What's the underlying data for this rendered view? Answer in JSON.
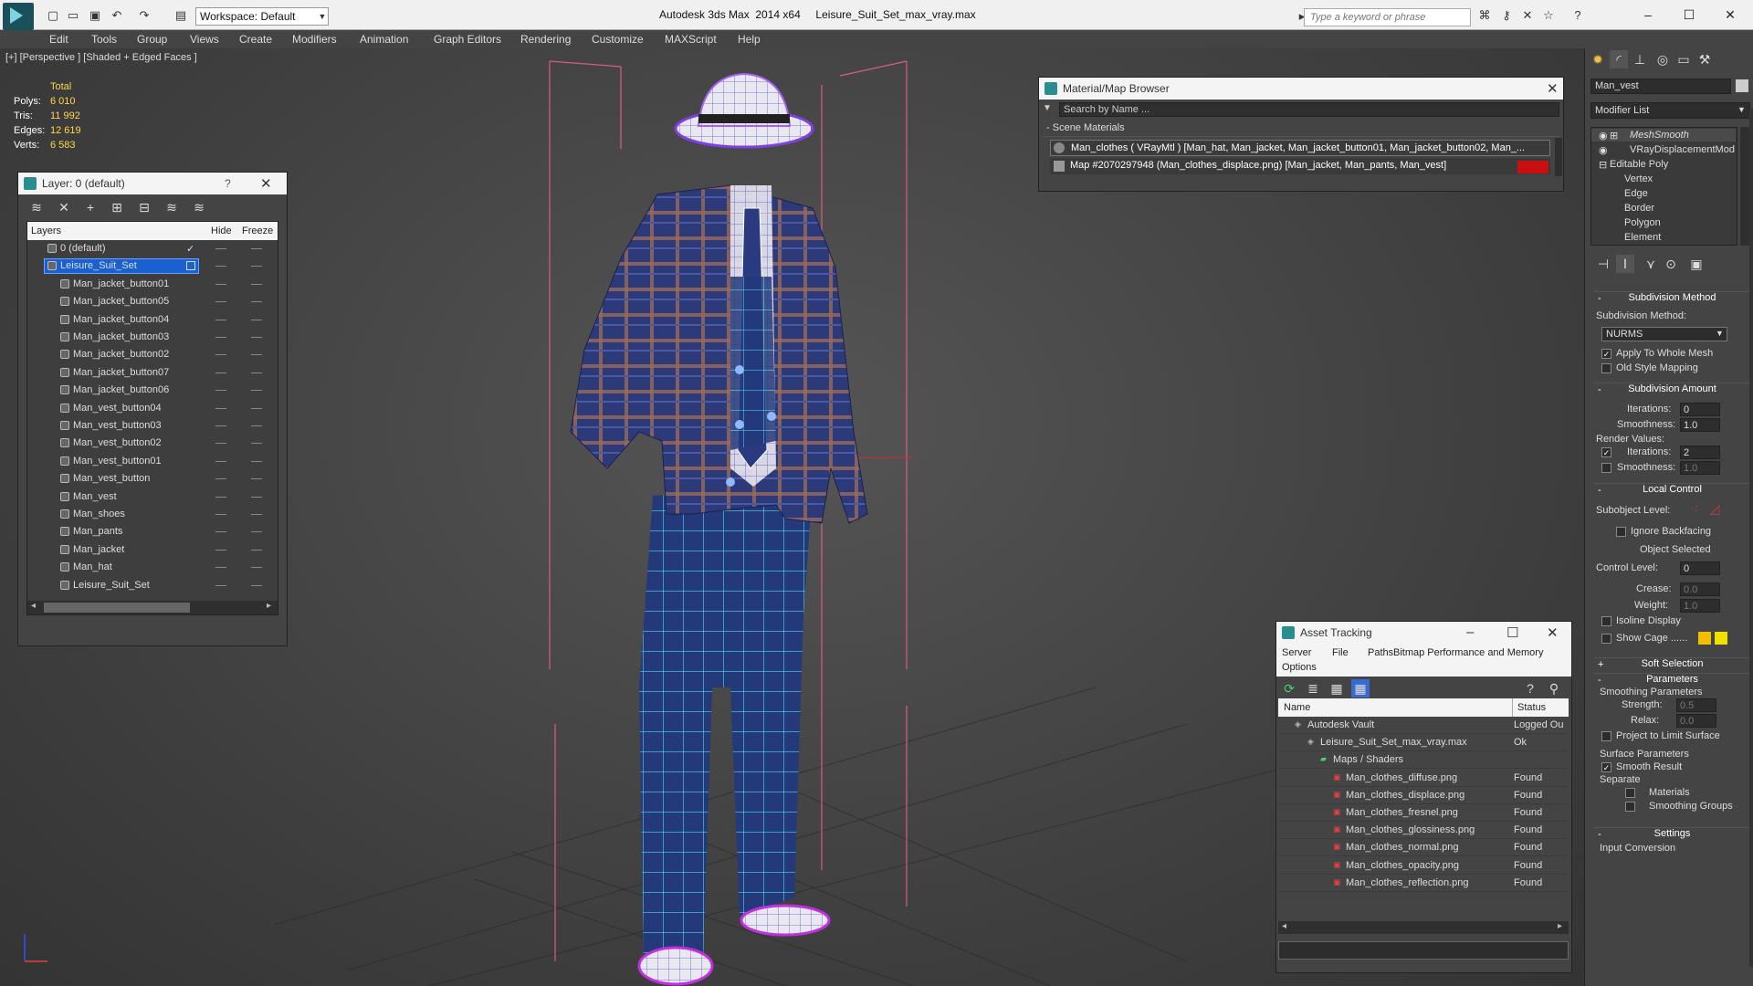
{
  "title_bar": {
    "workspace": "Workspace: Default",
    "app_title": "Autodesk 3ds Max  2014 x64     Leisure_Suit_Set_max_vray.max",
    "search_placeholder": "Type a keyword or phrase"
  },
  "menu": [
    "Edit",
    "Tools",
    "Group",
    "Views",
    "Create",
    "Modifiers",
    "Animation",
    "Graph Editors",
    "Rendering",
    "Customize",
    "MAXScript",
    "Help"
  ],
  "viewport": {
    "label": "[+] [Perspective ] [Shaded + Edged Faces ]",
    "stats": {
      "total_label": "Total",
      "rows": [
        {
          "label": "Polys:",
          "value": "6 010"
        },
        {
          "label": "Tris:",
          "value": "11 992"
        },
        {
          "label": "Edges:",
          "value": "12 619"
        },
        {
          "label": "Verts:",
          "value": "6 583"
        }
      ]
    }
  },
  "layer_dialog": {
    "title": "Layer: 0 (default)",
    "help": "?",
    "columns": {
      "layers": "Layers",
      "hide": "Hide",
      "freeze": "Freeze"
    },
    "rows": [
      {
        "name": "0 (default)",
        "level": 0
      },
      {
        "name": "Leisure_Suit_Set",
        "level": 0,
        "selected": true
      },
      {
        "name": "Man_jacket_button01",
        "level": 1
      },
      {
        "name": "Man_jacket_button05",
        "level": 1
      },
      {
        "name": "Man_jacket_button04",
        "level": 1
      },
      {
        "name": "Man_jacket_button03",
        "level": 1
      },
      {
        "name": "Man_jacket_button02",
        "level": 1
      },
      {
        "name": "Man_jacket_button07",
        "level": 1
      },
      {
        "name": "Man_jacket_button06",
        "level": 1
      },
      {
        "name": "Man_vest_button04",
        "level": 1
      },
      {
        "name": "Man_vest_button03",
        "level": 1
      },
      {
        "name": "Man_vest_button02",
        "level": 1
      },
      {
        "name": "Man_vest_button01",
        "level": 1
      },
      {
        "name": "Man_vest_button",
        "level": 1
      },
      {
        "name": "Man_vest",
        "level": 1
      },
      {
        "name": "Man_shoes",
        "level": 1
      },
      {
        "name": "Man_pants",
        "level": 1
      },
      {
        "name": "Man_jacket",
        "level": 1
      },
      {
        "name": "Man_hat",
        "level": 1
      },
      {
        "name": "Leisure_Suit_Set",
        "level": 1
      }
    ]
  },
  "material_browser": {
    "title": "Material/Map Browser",
    "search_placeholder": "Search by Name ...",
    "section": "Scene Materials",
    "items": [
      "Man_clothes  ( VRayMtl )  [Man_hat, Man_jacket, Man_jacket_button01, Man_jacket_button02, Man_...",
      "Map #2070297948 (Man_clothes_displace.png)  [Man_jacket, Man_pants, Man_vest]"
    ]
  },
  "asset_tracking": {
    "title": "Asset Tracking",
    "menu": [
      "Server",
      "File",
      "Paths",
      "Bitmap Performance and Memory",
      "Options"
    ],
    "columns": {
      "name": "Name",
      "status": "Status"
    },
    "rows": [
      {
        "name": "Autodesk Vault",
        "status": "Logged Ou",
        "indent": 1
      },
      {
        "name": "Leisure_Suit_Set_max_vray.max",
        "status": "Ok",
        "indent": 2
      },
      {
        "name": "Maps / Shaders",
        "status": "",
        "indent": 3
      },
      {
        "name": "Man_clothes_diffuse.png",
        "status": "Found",
        "indent": 4
      },
      {
        "name": "Man_clothes_displace.png",
        "status": "Found",
        "indent": 4
      },
      {
        "name": "Man_clothes_fresnel.png",
        "status": "Found",
        "indent": 4
      },
      {
        "name": "Man_clothes_glossiness.png",
        "status": "Found",
        "indent": 4
      },
      {
        "name": "Man_clothes_normal.png",
        "status": "Found",
        "indent": 4
      },
      {
        "name": "Man_clothes_opacity.png",
        "status": "Found",
        "indent": 4
      },
      {
        "name": "Man_clothes_reflection.png",
        "status": "Found",
        "indent": 4
      }
    ]
  },
  "command_panel": {
    "object_name": "Man_vest",
    "modifier_list": "Modifier List",
    "stack": [
      "MeshSmooth",
      "VRayDisplacementMod",
      "Editable Poly",
      "Vertex",
      "Edge",
      "Border",
      "Polygon",
      "Element"
    ],
    "subdivision_method": {
      "header": "Subdivision Method",
      "label": "Subdivision Method:",
      "value": "NURMS",
      "apply_whole_mesh": "Apply To Whole Mesh",
      "old_style_mapping": "Old Style Mapping"
    },
    "subdivision_amount": {
      "header": "Subdivision Amount",
      "iterations_label": "Iterations:",
      "iterations": "0",
      "smoothness_label": "Smoothness:",
      "smoothness": "1.0",
      "render_values": "Render Values:",
      "r_iterations_label": "Iterations:",
      "r_iterations": "2",
      "r_smoothness_label": "Smoothness:",
      "r_smoothness": "1.0"
    },
    "local_control": {
      "header": "Local Control",
      "subobject_level": "Subobject Level:",
      "ignore_backfacing": "Ignore Backfacing",
      "object_selected": "Object Selected",
      "control_level_label": "Control Level:",
      "control_level": "0",
      "crease_label": "Crease:",
      "crease": "0.0",
      "weight_label": "Weight:",
      "weight": "1.0",
      "isoline_display": "Isoline Display",
      "show_cage": "Show Cage ......"
    },
    "soft_selection": "Soft Selection",
    "parameters": {
      "header": "Parameters",
      "smoothing_params": "Smoothing Parameters",
      "strength_label": "Strength:",
      "strength": "0.5",
      "relax_label": "Relax:",
      "relax": "0.0",
      "project_limit": "Project to Limit Surface",
      "surface_params": "Surface Parameters",
      "smooth_result": "Smooth Result",
      "separate": "Separate",
      "materials": "Materials",
      "smoothing_groups": "Smoothing Groups"
    },
    "settings": "Settings",
    "input_conversion": "Input Conversion"
  }
}
